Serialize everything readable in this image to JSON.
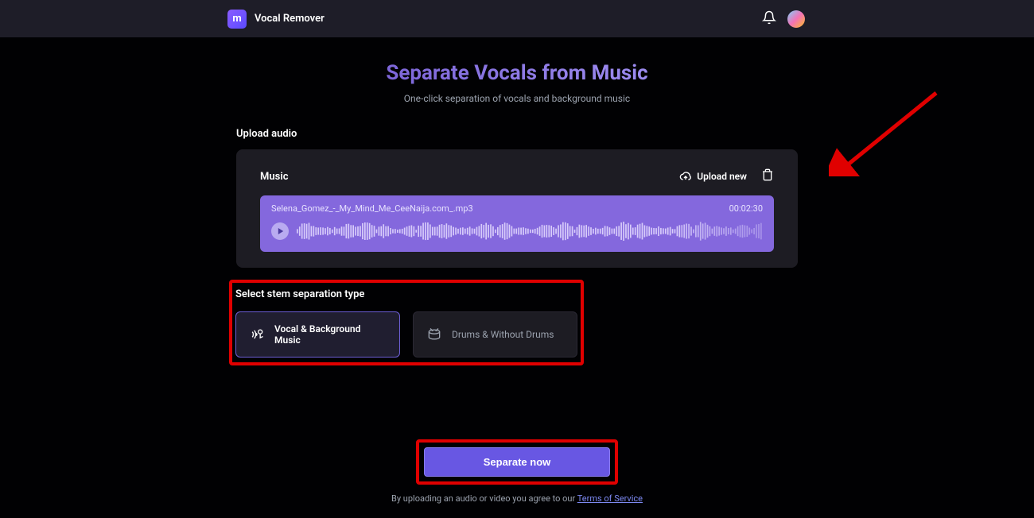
{
  "header": {
    "app_name": "Vocal Remover",
    "logo_letter": "m"
  },
  "hero": {
    "title": "Separate Vocals from Music",
    "subtitle": "One-click separation of vocals and background music"
  },
  "upload": {
    "section_label": "Upload audio",
    "card_title": "Music",
    "upload_new_label": "Upload new",
    "file_name": "Selena_Gomez_-_My_Mind_Me_CeeNaija.com_.mp3",
    "duration": "00:02:30"
  },
  "stem": {
    "label": "Select stem separation type",
    "options": [
      {
        "label": "Vocal & Background Music",
        "selected": true
      },
      {
        "label": "Drums & Without Drums",
        "selected": false
      }
    ]
  },
  "cta": {
    "button_label": "Separate now",
    "tos_text": "By uploading an audio or video you agree to our ",
    "tos_link": "Terms of Service"
  }
}
